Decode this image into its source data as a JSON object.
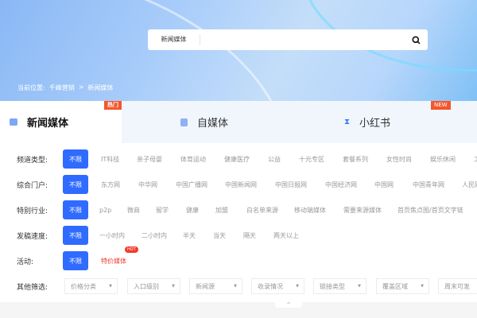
{
  "search": {
    "category": "新闻媒体",
    "placeholder": ""
  },
  "breadcrumb": {
    "prefix": "当前位置:",
    "home": "千峰营销",
    "sep": ">",
    "current": "新闻媒体"
  },
  "tabs": [
    {
      "label": "新闻媒体",
      "badge": "热门"
    },
    {
      "label": "自媒体"
    },
    {
      "label": "小红书",
      "badge": "NEW"
    }
  ],
  "filters": {
    "all_label": "不限",
    "channel": {
      "label": "频道类型:",
      "options": [
        "IT科技",
        "亲子母婴",
        "体育运动",
        "健康医疗",
        "公益",
        "十元专区",
        "套餐系列",
        "女性时尚",
        "娱乐休闲",
        "工"
      ]
    },
    "portal": {
      "label": "综合门户:",
      "options": [
        "东方网",
        "中华网",
        "中国广播网",
        "中国新闻网",
        "中国日报网",
        "中国经济网",
        "中国网",
        "中国青年网",
        "人民网"
      ]
    },
    "industry": {
      "label": "特别行业:",
      "options": [
        "p2p",
        "微商",
        "留学",
        "健康",
        "加盟",
        "白名单来源",
        "移动端媒体",
        "需要来源媒体",
        "首页焦点图/首页文字链"
      ]
    },
    "speed": {
      "label": "发稿速度:",
      "options": [
        "一小时内",
        "二小时内",
        "半天",
        "当天",
        "隔天",
        "两天以上"
      ]
    },
    "activity": {
      "label": "活动:",
      "option": "特价媒体",
      "badge": "HOT"
    },
    "other": {
      "label": "其他筛选:",
      "dropdowns": [
        "价格分类",
        "入口级别",
        "新闻源",
        "收录情况",
        "链接类型",
        "覆盖区域",
        "周末可发"
      ]
    }
  },
  "collapse_icon": "^",
  "colors": {
    "accent": "#2f6bff",
    "hot": "#f03a2a"
  }
}
